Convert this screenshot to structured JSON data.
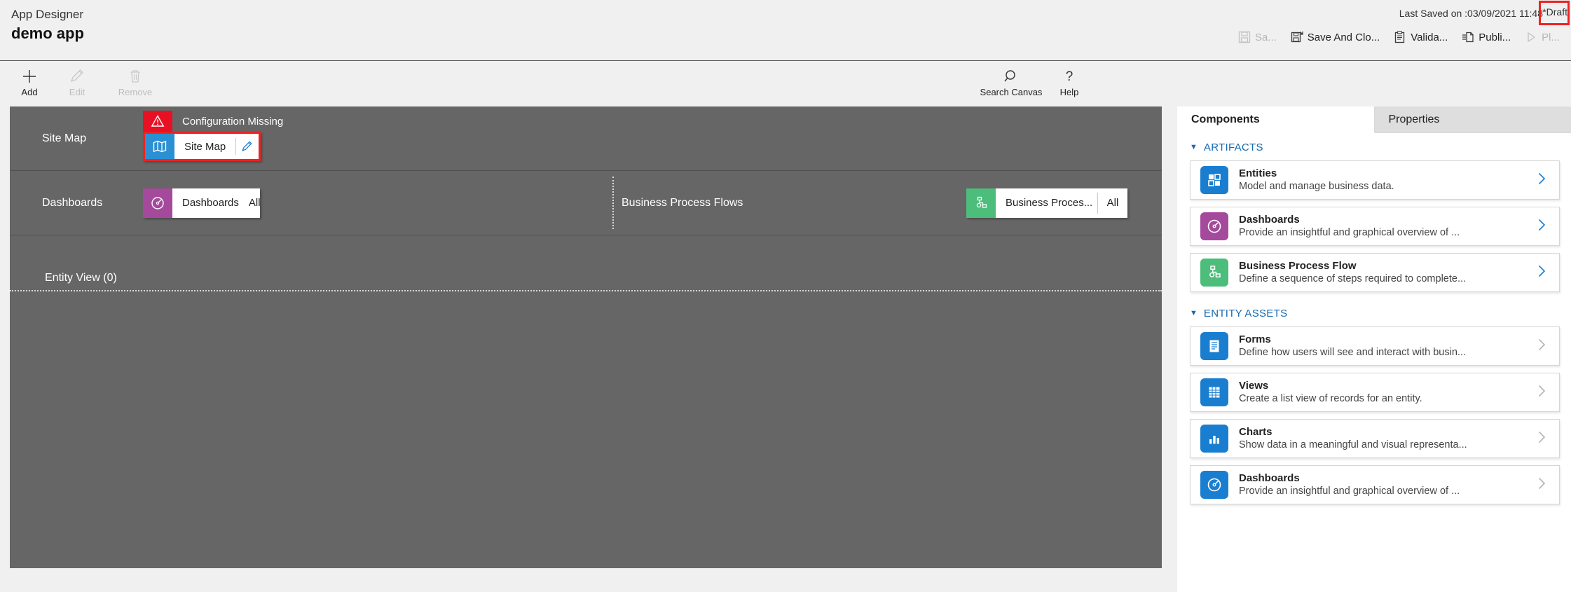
{
  "header": {
    "app_label": "App Designer",
    "app_name": "demo app",
    "last_saved": "Last Saved on :03/09/2021 11:48",
    "draft_status": "*Draft",
    "actions": [
      {
        "label": "Sa...",
        "icon": "save-icon",
        "disabled": true
      },
      {
        "label": "Save And Clo...",
        "icon": "save-and-close-icon",
        "disabled": false
      },
      {
        "label": "Valida...",
        "icon": "validate-icon",
        "disabled": false
      },
      {
        "label": "Publi...",
        "icon": "publish-icon",
        "disabled": false
      },
      {
        "label": "Pl...",
        "icon": "play-icon",
        "disabled": true
      }
    ]
  },
  "commandbar": {
    "left": [
      {
        "label": "Add",
        "icon": "plus-icon",
        "disabled": false
      },
      {
        "label": "Edit",
        "icon": "pencil-icon",
        "disabled": true
      },
      {
        "label": "Remove",
        "icon": "trash-icon",
        "disabled": true
      }
    ],
    "right": [
      {
        "label": "Search Canvas",
        "icon": "search-icon",
        "disabled": false
      },
      {
        "label": "Help",
        "icon": "question-mark-icon",
        "disabled": false
      }
    ]
  },
  "canvas": {
    "sitemap_row": {
      "label": "Site Map",
      "warning": "Configuration Missing",
      "warning_icon": "warning-triangle-icon",
      "tile_label": "Site Map",
      "tile_icon": "map-icon",
      "edit_icon": "pencil-icon",
      "selected": true
    },
    "dashboards_row": {
      "label": "Dashboards",
      "tile_label": "Dashboards",
      "tile_icon": "gauge-icon",
      "tile_scope": "All"
    },
    "bpf_row": {
      "label": "Business Process Flows",
      "tile_label": "Business Proces...",
      "tile_icon": "process-flow-icon",
      "tile_scope": "All"
    },
    "entity_row": {
      "label": "Entity View (0)"
    }
  },
  "right_panel": {
    "tabs": [
      {
        "label": "Components",
        "active": true
      },
      {
        "label": "Properties",
        "active": false
      }
    ],
    "sections": [
      {
        "label": "ARTIFACTS",
        "expanded": true,
        "cards": [
          {
            "title": "Entities",
            "desc": "Model and manage business data.",
            "icon": "entities-icon",
            "color": "ci-blue",
            "chev": "strong"
          },
          {
            "title": "Dashboards",
            "desc": "Provide an insightful and graphical overview of ...",
            "icon": "gauge-icon",
            "color": "ci-purple",
            "chev": "strong"
          },
          {
            "title": "Business Process Flow",
            "desc": "Define a sequence of steps required to complete...",
            "icon": "process-flow-icon",
            "color": "ci-green",
            "chev": "strong"
          }
        ]
      },
      {
        "label": "ENTITY ASSETS",
        "expanded": true,
        "cards": [
          {
            "title": "Forms",
            "desc": "Define how users will see and interact with busin...",
            "icon": "form-icon",
            "color": "ci-blue",
            "chev": "weak"
          },
          {
            "title": "Views",
            "desc": "Create a list view of records for an entity.",
            "icon": "grid-icon",
            "color": "ci-blue",
            "chev": "weak"
          },
          {
            "title": "Charts",
            "desc": "Show data in a meaningful and visual representa...",
            "icon": "bar-chart-icon",
            "color": "ci-blue",
            "chev": "weak"
          },
          {
            "title": "Dashboards",
            "desc": "Provide an insightful and graphical overview of ...",
            "icon": "gauge-icon",
            "color": "ci-blue",
            "chev": "weak"
          }
        ]
      }
    ]
  },
  "colors": {
    "accent_blue": "#1a7ed0",
    "warning_red": "#e81123",
    "selection_red": "#ee2222",
    "purple": "#a5499c",
    "green": "#4cbd7b",
    "canvas_grey": "#666666"
  }
}
